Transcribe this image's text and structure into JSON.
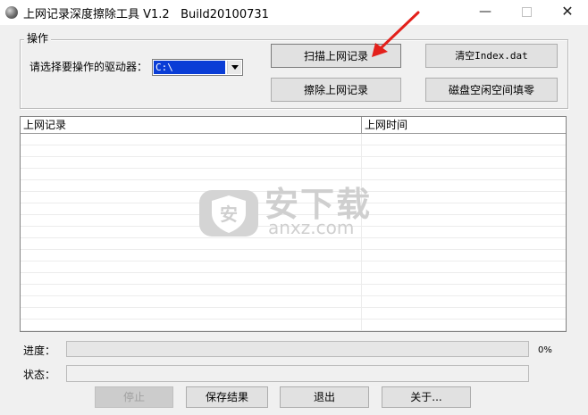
{
  "window": {
    "title": "上网记录深度擦除工具 V1.2   Build20100731",
    "minimize": "—",
    "close": "✕"
  },
  "group": {
    "label": "操作",
    "drive_label": "请选择要操作的驱动器：",
    "drive_value": "C:\\"
  },
  "buttons": {
    "scan": "扫描上网记录",
    "clear_index": "清空Index.dat",
    "erase": "擦除上网记录",
    "fill_disk": "磁盘空闲空间填零"
  },
  "list": {
    "columns": [
      "上网记录",
      "上网时间"
    ],
    "rows": []
  },
  "watermark": {
    "text": "安下载",
    "sub": "anxz.com"
  },
  "progress": {
    "label": "进度：",
    "value": 0,
    "percent_text": "0%"
  },
  "status": {
    "label": "状态：",
    "text": ""
  },
  "bottom": {
    "stop": "停止",
    "save": "保存结果",
    "exit": "退出",
    "about": "关于..."
  },
  "colors": {
    "annotation_arrow": "#e3201b",
    "selection": "#0a3dd6"
  }
}
